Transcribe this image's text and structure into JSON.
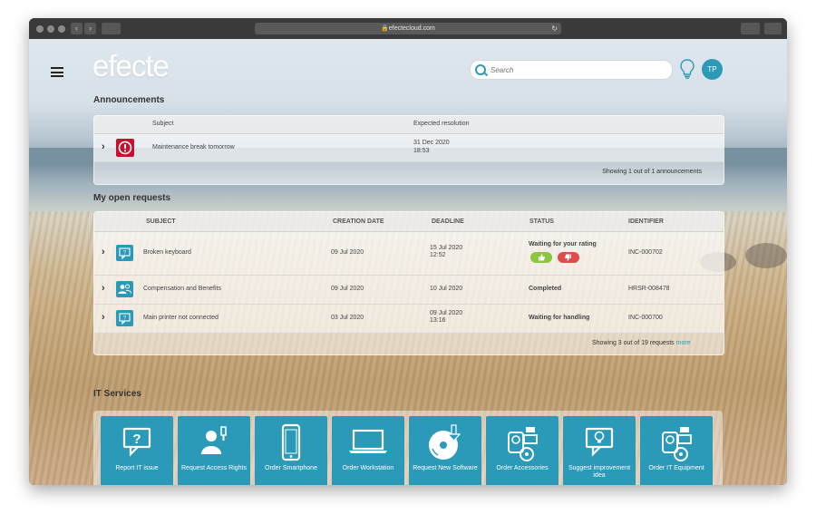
{
  "browser": {
    "url": "efectecloud.com",
    "secure_icon": "lock-icon",
    "reload_icon": "reload-icon"
  },
  "header": {
    "logo": "efecte",
    "search_placeholder": "Search",
    "avatar_initials": "TP",
    "menu_icon": "hamburger-icon",
    "bulb_icon": "lightbulb-icon"
  },
  "announcements": {
    "title": "Announcements",
    "columns": {
      "subject": "Subject",
      "expected": "Expected resolution"
    },
    "rows": [
      {
        "subject": "Maintenance break tomorrow",
        "date": "31 Dec 2020",
        "time": "18:53",
        "icon": "alert-icon"
      }
    ],
    "footer": "Showing 1 out of 1 announcements"
  },
  "requests": {
    "title": "My open requests",
    "columns": {
      "subject": "SUBJECT",
      "created": "CREATION DATE",
      "deadline": "DEADLINE",
      "status": "STATUS",
      "identifier": "IDENTIFIER"
    },
    "rows": [
      {
        "subject": "Broken keyboard",
        "created": "09 Jul 2020",
        "deadline": "15 Jul 2020",
        "deadline_time": "12:52",
        "status": "Waiting for your rating",
        "identifier": "INC-000702",
        "icon": "chat-question-icon"
      },
      {
        "subject": "Compensation and Benefits",
        "created": "09 Jul 2020",
        "deadline": "10 Jul 2020",
        "deadline_time": "",
        "status": "Completed",
        "identifier": "HRSR-008478",
        "icon": "people-icon"
      },
      {
        "subject": "Main printer not connected",
        "created": "03 Jul 2020",
        "deadline": "09 Jul 2020",
        "deadline_time": "13:16",
        "status": "Waiting for handling",
        "identifier": "INC-000700",
        "icon": "chat-question-icon"
      }
    ],
    "footer": "Showing 3 out of 19 requests",
    "more": "more"
  },
  "services": {
    "title": "IT Services",
    "tiles": [
      {
        "label": "Report IT issue",
        "icon": "chat-question-icon"
      },
      {
        "label": "Request Access Rights",
        "icon": "user-key-icon"
      },
      {
        "label": "Order Smartphone",
        "icon": "smartphone-icon"
      },
      {
        "label": "Order Workstation",
        "icon": "laptop-icon"
      },
      {
        "label": "Request New Software",
        "icon": "disc-download-icon"
      },
      {
        "label": "Order Accessories",
        "icon": "devices-icon"
      },
      {
        "label": "Suggest improvement idea",
        "icon": "chat-bulb-icon"
      },
      {
        "label": "Order IT Equipment",
        "icon": "devices-icon"
      }
    ]
  },
  "colors": {
    "accent": "#2a9ab8",
    "alert": "#c8102e",
    "approve": "#8cc63f",
    "reject": "#e04b4b"
  }
}
